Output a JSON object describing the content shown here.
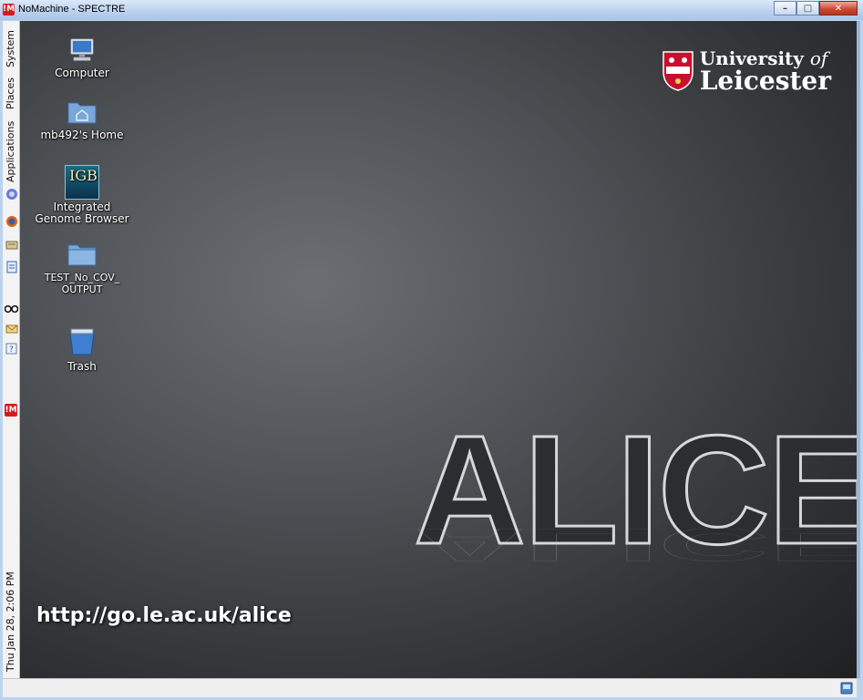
{
  "window": {
    "title": "NoMachine - SPECTRE",
    "app_icon": "!M",
    "minimize": "–",
    "maximize": "□",
    "close": "✕"
  },
  "panel": {
    "system": "System",
    "places": "Places",
    "applications": "Applications",
    "clock": "Thu Jan 28,  2:06 PM",
    "nomachine_icon": "!M",
    "launchers": [
      "gnome-icon",
      "firefox-icon",
      "text-editor-icon",
      "document-icon",
      "glasses-icon",
      "mail-icon",
      "help-icon"
    ]
  },
  "desktop": {
    "icons": [
      {
        "label": "Computer",
        "icon": "computer-icon"
      },
      {
        "label": "mb492's Home",
        "icon": "home-folder-icon"
      },
      {
        "label": "Integrated Genome Browser",
        "icon": "igb-icon",
        "icon_text": "IGB"
      },
      {
        "label": "TEST_No_COV_ OUTPUT",
        "icon": "folder-icon"
      },
      {
        "label": "Trash",
        "icon": "trash-icon"
      }
    ],
    "logo": {
      "line1a": "University",
      "line1b": "of",
      "line2": "Leicester"
    },
    "watermark": "ALICE",
    "url": "http://go.le.ac.uk/alice"
  },
  "colors": {
    "accent_red": "#d21d1d",
    "desktop_dark": "#2f3134",
    "titlebar": "#bcd2ee"
  }
}
